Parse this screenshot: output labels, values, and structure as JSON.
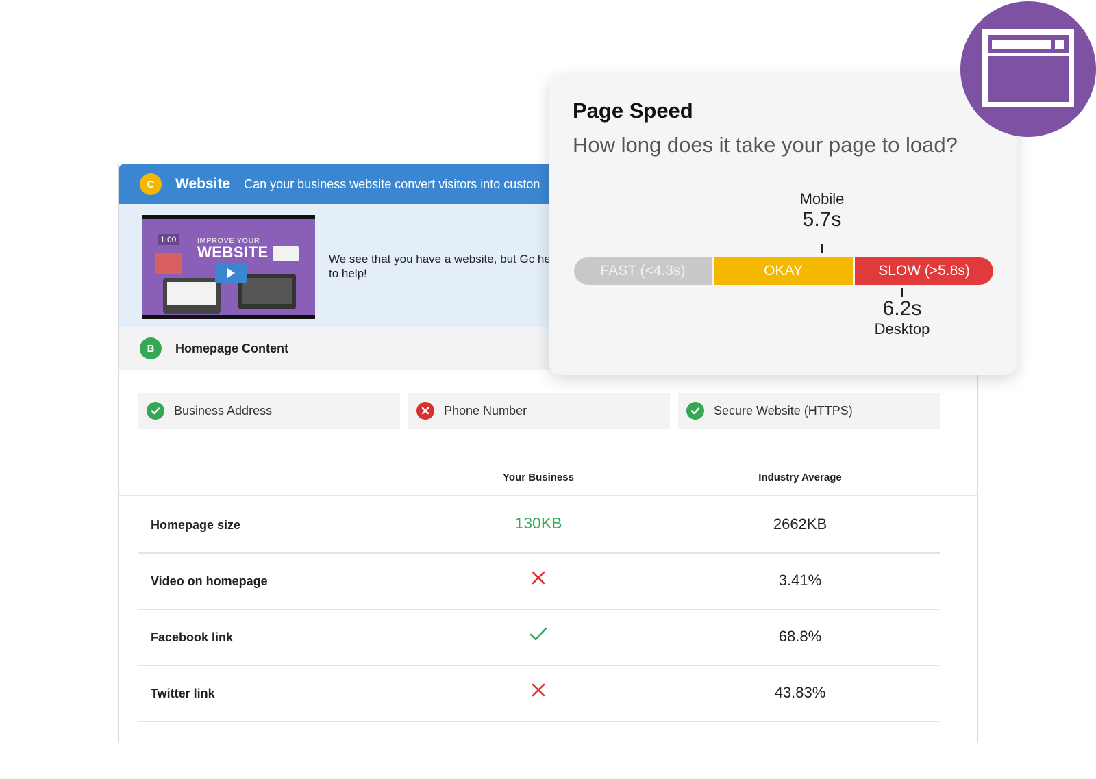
{
  "website_section": {
    "grade": "C",
    "title": "Website",
    "subtitle": "Can your business website convert visitors into custon",
    "video": {
      "timecode": "1:00",
      "title_line1": "IMPROVE YOUR",
      "title_line2": "WEBSITE"
    },
    "description": "We see that you have a website, but Gc here to help!"
  },
  "homepage_section": {
    "grade": "B",
    "title": "Homepage Content"
  },
  "checks": [
    {
      "label": "Business Address",
      "status": "pass"
    },
    {
      "label": "Phone Number",
      "status": "fail"
    },
    {
      "label": "Secure Website (HTTPS)",
      "status": "pass"
    }
  ],
  "table": {
    "headers": {
      "yours": "Your Business",
      "average": "Industry Average"
    },
    "rows": [
      {
        "label": "Homepage size",
        "yours": "130KB",
        "yours_type": "text",
        "average": "2662KB"
      },
      {
        "label": "Video on homepage",
        "yours": "",
        "yours_type": "cross",
        "average": "3.41%"
      },
      {
        "label": "Facebook link",
        "yours": "",
        "yours_type": "check",
        "average": "68.8%"
      },
      {
        "label": "Twitter link",
        "yours": "",
        "yours_type": "cross",
        "average": "43.83%"
      }
    ]
  },
  "page_speed": {
    "title": "Page Speed",
    "question": "How long does it take your page to load?",
    "segments": {
      "fast": "FAST (<4.3s)",
      "okay": "OKAY",
      "slow": "SLOW (>5.8s)"
    },
    "mobile": {
      "label": "Mobile",
      "value": "5.7s"
    },
    "desktop": {
      "label": "Desktop",
      "value": "6.2s"
    }
  },
  "colors": {
    "header_blue": "#3b86d1",
    "grade_c": "#f5b800",
    "grade_b": "#35a853",
    "pass_green": "#35a853",
    "fail_red": "#d93030",
    "badge_purple": "#7e52a3"
  },
  "icons": {
    "badge": "browser-window-icon",
    "pass": "check-circle-icon",
    "fail": "x-circle-icon"
  }
}
